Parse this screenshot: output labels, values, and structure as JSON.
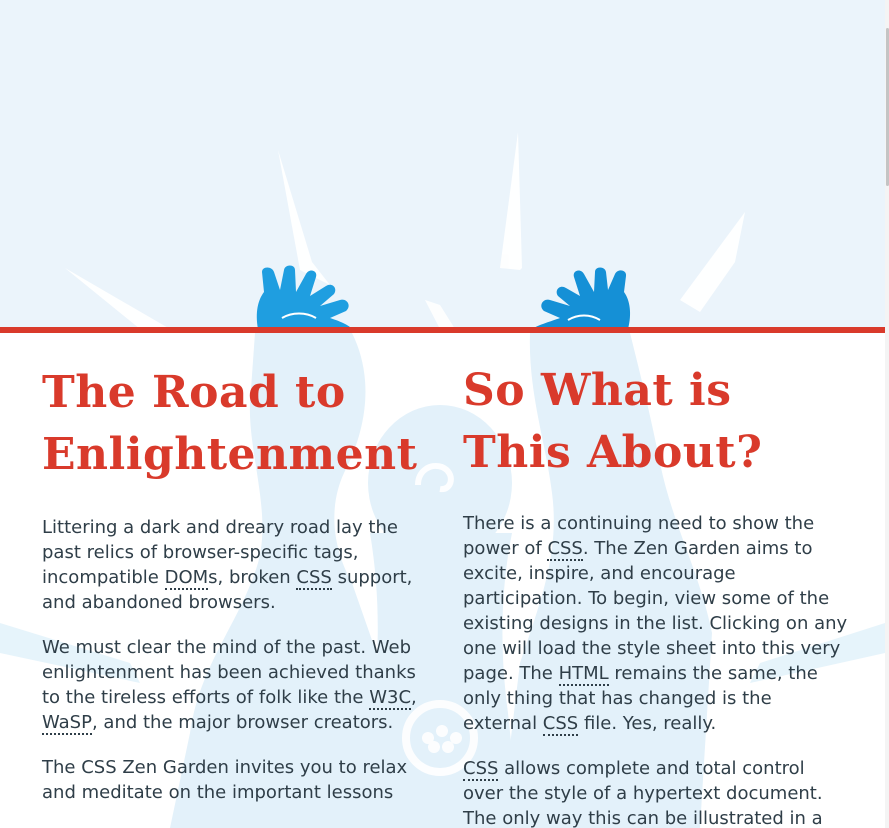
{
  "colors": {
    "accent": "#d93a2b",
    "sky": "#ebf4fb",
    "art_light": "#d6ecf8",
    "art_blue": "#1f9ee0",
    "text": "#2f3e48"
  },
  "left": {
    "heading": "The Road to Enlightenment",
    "paragraphs": [
      {
        "t1": "Littering a dark and dreary road lay the past relics of browser-specific tags, incompatible ",
        "abbr1": "DOM",
        "t2": "s, broken ",
        "abbr2": "CSS",
        "t3": " support, and abandoned browsers."
      },
      {
        "t1": "We must clear the mind of the past. Web enlightenment has been achieved thanks to the tireless efforts of folk like the ",
        "abbr1": "W3C",
        "t2": ", ",
        "abbr2": "WaSP",
        "t3": ", and the major browser creators."
      },
      {
        "t1": "The CSS Zen Garden invites you to relax and meditate on the important lessons"
      }
    ]
  },
  "right": {
    "heading": "So What is This About?",
    "paragraphs": [
      {
        "t1": "There is a continuing need to show the power of ",
        "abbr1": "CSS",
        "t2": ". The Zen Garden aims to excite, inspire, and encourage participation. To begin, view some of the existing designs in the list. Clicking on any one will load the style sheet into this very page. The ",
        "abbr2": "HTML",
        "t3": " remains the same, the only thing that has changed is the external ",
        "abbr3": "CSS",
        "t4": " file. Yes, really."
      },
      {
        "abbr1": "CSS",
        "t1": " allows complete and total control over the style of a hypertext document. The only way this can be illustrated in a"
      }
    ]
  }
}
